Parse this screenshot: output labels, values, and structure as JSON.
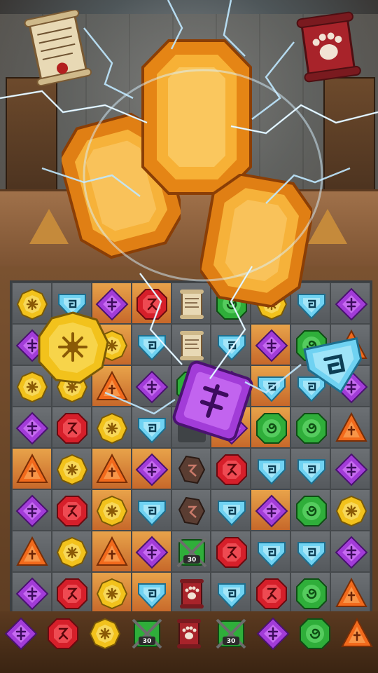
{
  "game": {
    "colors": {
      "yellow": "#f2c21c",
      "blue": "#6fd2f2",
      "purple": "#a23cd8",
      "red": "#d61f2a",
      "orange": "#f26a1c",
      "green": "#2fae3a",
      "amber": "#f5a21a"
    },
    "scrolls": [
      {
        "name": "parchment-scroll-icon"
      },
      {
        "name": "paw-scroll-icon"
      }
    ],
    "board": {
      "rows": 8,
      "cols": 9,
      "grid": [
        [
          "Y",
          "B",
          "P",
          "R",
          "S",
          "G",
          "Y",
          "B",
          "P"
        ],
        [
          "P",
          "Y",
          "Y",
          "B",
          "S",
          "B",
          "P",
          "G",
          "O"
        ],
        [
          "Y",
          "Y",
          "O",
          "P",
          "G",
          "P",
          "B",
          "B",
          "P"
        ],
        [
          "P",
          "R",
          "Y",
          "B",
          "E",
          "P",
          "G",
          "G",
          "O"
        ],
        [
          "O",
          "Y",
          "O",
          "P",
          "K",
          "R",
          "B",
          "B",
          "P"
        ],
        [
          "P",
          "R",
          "Y",
          "B",
          "K",
          "B",
          "P",
          "G",
          "Y"
        ],
        [
          "O",
          "Y",
          "O",
          "P",
          "C",
          "R",
          "B",
          "B",
          "P"
        ],
        [
          "P",
          "R",
          "Y",
          "B",
          "D",
          "B",
          "R",
          "G",
          "O"
        ]
      ],
      "lit": [
        [
          0,
          2
        ],
        [
          0,
          3
        ],
        [
          1,
          2
        ],
        [
          1,
          6
        ],
        [
          2,
          2
        ],
        [
          2,
          6
        ],
        [
          3,
          5
        ],
        [
          3,
          6
        ],
        [
          4,
          0
        ],
        [
          4,
          2
        ],
        [
          4,
          3
        ],
        [
          5,
          2
        ],
        [
          5,
          6
        ],
        [
          6,
          2
        ],
        [
          6,
          3
        ],
        [
          7,
          2
        ],
        [
          7,
          3
        ]
      ],
      "chain_counter": "30"
    },
    "bottom_row": [
      "P",
      "R",
      "Y",
      "G",
      "D",
      "G",
      "P",
      "G",
      "O"
    ],
    "chain_labels": [
      "30",
      "30"
    ]
  }
}
